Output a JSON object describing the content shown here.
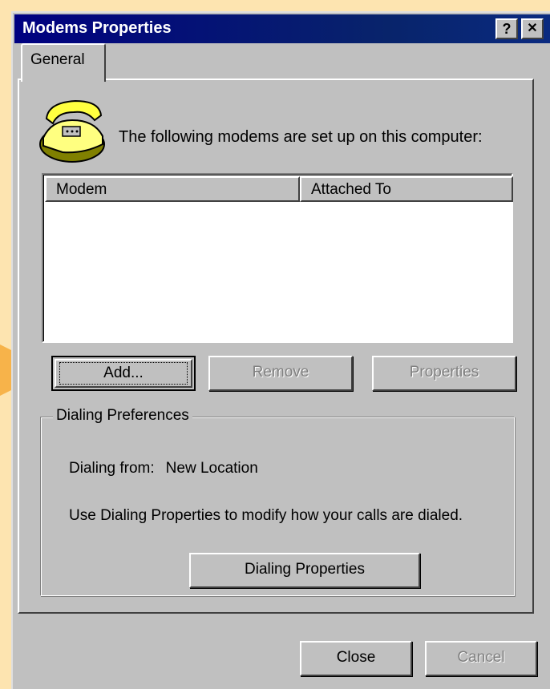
{
  "window": {
    "title": "Modems Properties",
    "help_btn": "?",
    "close_btn": "✕"
  },
  "tabs": [
    {
      "label": "General"
    }
  ],
  "general": {
    "intro": "The following modems are set up on this computer:",
    "list": {
      "columns": [
        "Modem",
        "Attached To"
      ],
      "rows": []
    },
    "buttons": {
      "add": "Add...",
      "remove": "Remove",
      "properties": "Properties"
    },
    "dialing": {
      "legend": "Dialing Preferences",
      "from_label": "Dialing from:",
      "from_value": "New Location",
      "description": "Use Dialing Properties to modify how your calls are dialed.",
      "button": "Dialing Properties"
    }
  },
  "footer": {
    "close": "Close",
    "cancel": "Cancel"
  },
  "colors": {
    "titlebar": "#000080",
    "face": "#c0c0c0",
    "backdrop": "#fde4b0",
    "arrow": "#f7b34a"
  }
}
